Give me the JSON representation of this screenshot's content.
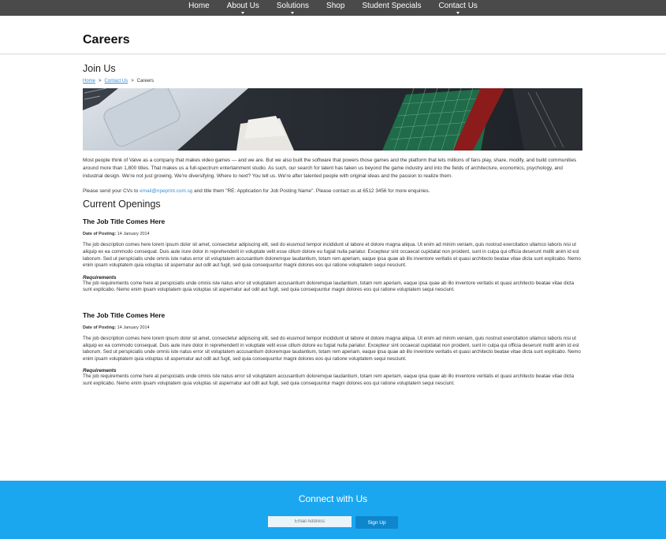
{
  "nav": {
    "items": [
      {
        "label": "Home",
        "has_caret": false
      },
      {
        "label": "About Us",
        "has_caret": true
      },
      {
        "label": "Solutions",
        "has_caret": true
      },
      {
        "label": "Shop",
        "has_caret": false
      },
      {
        "label": "Student Specials",
        "has_caret": false
      },
      {
        "label": "Contact Us",
        "has_caret": true
      }
    ]
  },
  "page": {
    "title": "Careers"
  },
  "join": {
    "heading": "Join Us",
    "breadcrumb": [
      "Home",
      "Contact Us",
      "Careers"
    ],
    "breadcrumb_sep": ">",
    "intro": "Most people think of Valve as a company that makes video games — and we are. But we also built the software that powers those games and the platform that lets millions of fans play, share, modify, and build communities around more than 1,800 titles. That makes us a full-spectrum entertainment studio. As such, our search for talent has taken us beyond the game industry and into the fields of architecture, economics, psychology, and industrial design. We're not just growing. We're diversifying. Where to next? You tell us. We're after talented people with original ideas and the passion to realize them.",
    "contact_prefix": "Please send your CVs to ",
    "contact_email": "email@npeprint.com.sg",
    "contact_suffix": " and title them \"RE: Application for Job Posting Name\". Please contact us at 6512 3456 for more enquiries."
  },
  "openings": {
    "heading": "Current Openings",
    "jobs": [
      {
        "title": "The Job Title Comes Here",
        "date_label": "Date of Posting:",
        "date": "14 January 2014",
        "description": "The job description comes here lorem ipsum dolor sit amet, consectetur adipiscing elit, sed do eiusmod tempor incididunt ut labore et dolore magna aliqua. Ut enim ad minim veniam, quis nostrud exercitation ullamco laboris nisi ut aliquip ex ea commodo consequat. Duis aute irure dolor in reprehenderit in voluptate velit esse cillum dolore eu fugiat nulla pariatur. Excepteur sint occaecat cupidatat non proident, sunt in culpa qui officia deserunt mollit anim id est laborum. Sed ut perspiciatis unde omnis iste natus error sit voluptatem accusantium doloremque laudantium, totam rem aperiam, eaque ipsa quae ab illo inventore veritatis et quasi architecto beatae vitae dicta sunt explicabo. Nemo enim ipsam voluptatem quia voluptas sit aspernatur aut odit aut fugit, sed quia consequuntur magni dolores eos qui ratione voluptatem sequi nesciunt.",
        "req_label": "Requirements",
        "requirements": "The job requirements come here at perspiciatis unde omnis iste natus error sit voluptatem accusantium doloremque laudantium, totam rem aperiam, eaque ipsa quae ab illo inventore veritatis et quasi architecto beatae vitae dicta sunt explicabo. Nemo enim ipsam voluptatem quia voluptas sit aspernatur aut odit aut fugit, sed quia consequuntur magni dolores eos qui ratione voluptatem sequi nesciunt."
      },
      {
        "title": "The Job Title Comes Here",
        "date_label": "Date of Posting:",
        "date": "14 January 2014",
        "description": "The job description comes here lorem ipsum dolor sit amet, consectetur adipiscing elit, sed do eiusmod tempor incididunt ut labore et dolore magna aliqua. Ut enim ad minim veniam, quis nostrud exercitation ullamco laboris nisi ut aliquip ex ea commodo consequat. Duis aute irure dolor in reprehenderit in voluptate velit esse cillum dolore eu fugiat nulla pariatur. Excepteur sint occaecat cupidatat non proident, sunt in culpa qui officia deserunt mollit anim id est laborum. Sed ut perspiciatis unde omnis iste natus error sit voluptatem accusantium doloremque laudantium, totam rem aperiam, eaque ipsa quae ab illo inventore veritatis et quasi architecto beatae vitae dicta sunt explicabo. Nemo enim ipsam voluptatem quia voluptas sit aspernatur aut odit aut fugit, sed quia consequuntur magni dolores eos qui ratione voluptatem sequi nesciunt.",
        "req_label": "Requirements",
        "requirements": "The job requirements come here at perspiciatis unde omnis iste natus error sit voluptatem accusantium doloremque laudantium, totam rem aperiam, eaque ipsa quae ab illo inventore veritatis et quasi architecto beatae vitae dicta sunt explicabo. Nemo enim ipsam voluptatem quia voluptas sit aspernatur aut odit aut fugit, sed quia consequuntur magni dolores eos qui ratione voluptatem sequi nesciunt."
      }
    ]
  },
  "footer": {
    "title": "Connect with Us",
    "email_placeholder": "Email Address",
    "signup_label": "Sign Up"
  },
  "colors": {
    "nav_bg": "#4a4a4a",
    "link": "#3a8fd6",
    "footer_bg": "#1aa7f0",
    "button_bg": "#0e86cc"
  }
}
